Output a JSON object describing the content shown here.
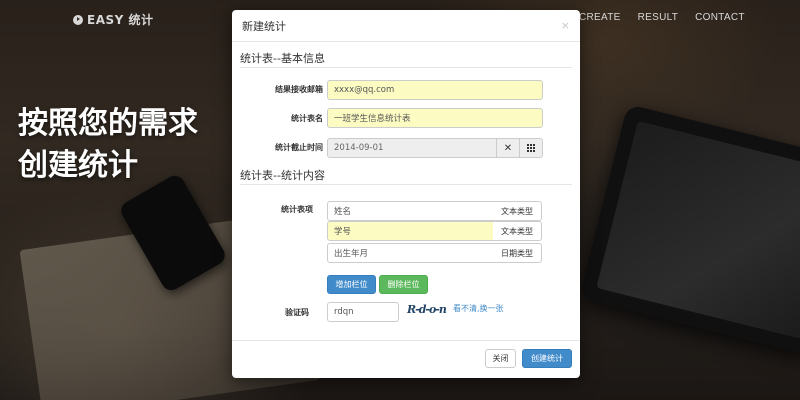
{
  "brand": {
    "name": "EASY 统计",
    "icon": "play-circle-icon"
  },
  "nav": {
    "items": [
      "CREATE",
      "RESULT",
      "CONTACT"
    ]
  },
  "hero": {
    "line1": "按照您的需求",
    "line2": "创建统计"
  },
  "modal": {
    "title": "新建统计",
    "close": "×",
    "basic_section": "统计表--基本信息",
    "content_section": "统计表--统计内容",
    "email": {
      "label": "结果接收邮箱",
      "value": "xxxx@qq.com"
    },
    "name": {
      "label": "统计表名",
      "value": "一班学生信息统计表"
    },
    "deadline": {
      "label": "统计截止时间",
      "value": "2014-09-01",
      "clear_icon": "times-icon",
      "calendar_icon": "grid-calendar-icon"
    },
    "items_label": "统计表项",
    "items": [
      {
        "name": "姓名",
        "type": "文本类型",
        "highlight": false
      },
      {
        "name": "学号",
        "type": "文本类型",
        "highlight": true
      },
      {
        "name": "出生年月",
        "type": "日期类型",
        "highlight": false
      }
    ],
    "add_button": "增加栏位",
    "delete_button": "删除栏位",
    "captcha": {
      "label": "验证码",
      "value": "rdqn",
      "image_text": "R-d-o-n",
      "refresh_link": "看不清,换一张"
    },
    "close_button": "关闭",
    "create_button": "创建统计"
  },
  "colors": {
    "primary": "#428bca",
    "success": "#5cb85c",
    "autofill": "#fbfbc2"
  }
}
